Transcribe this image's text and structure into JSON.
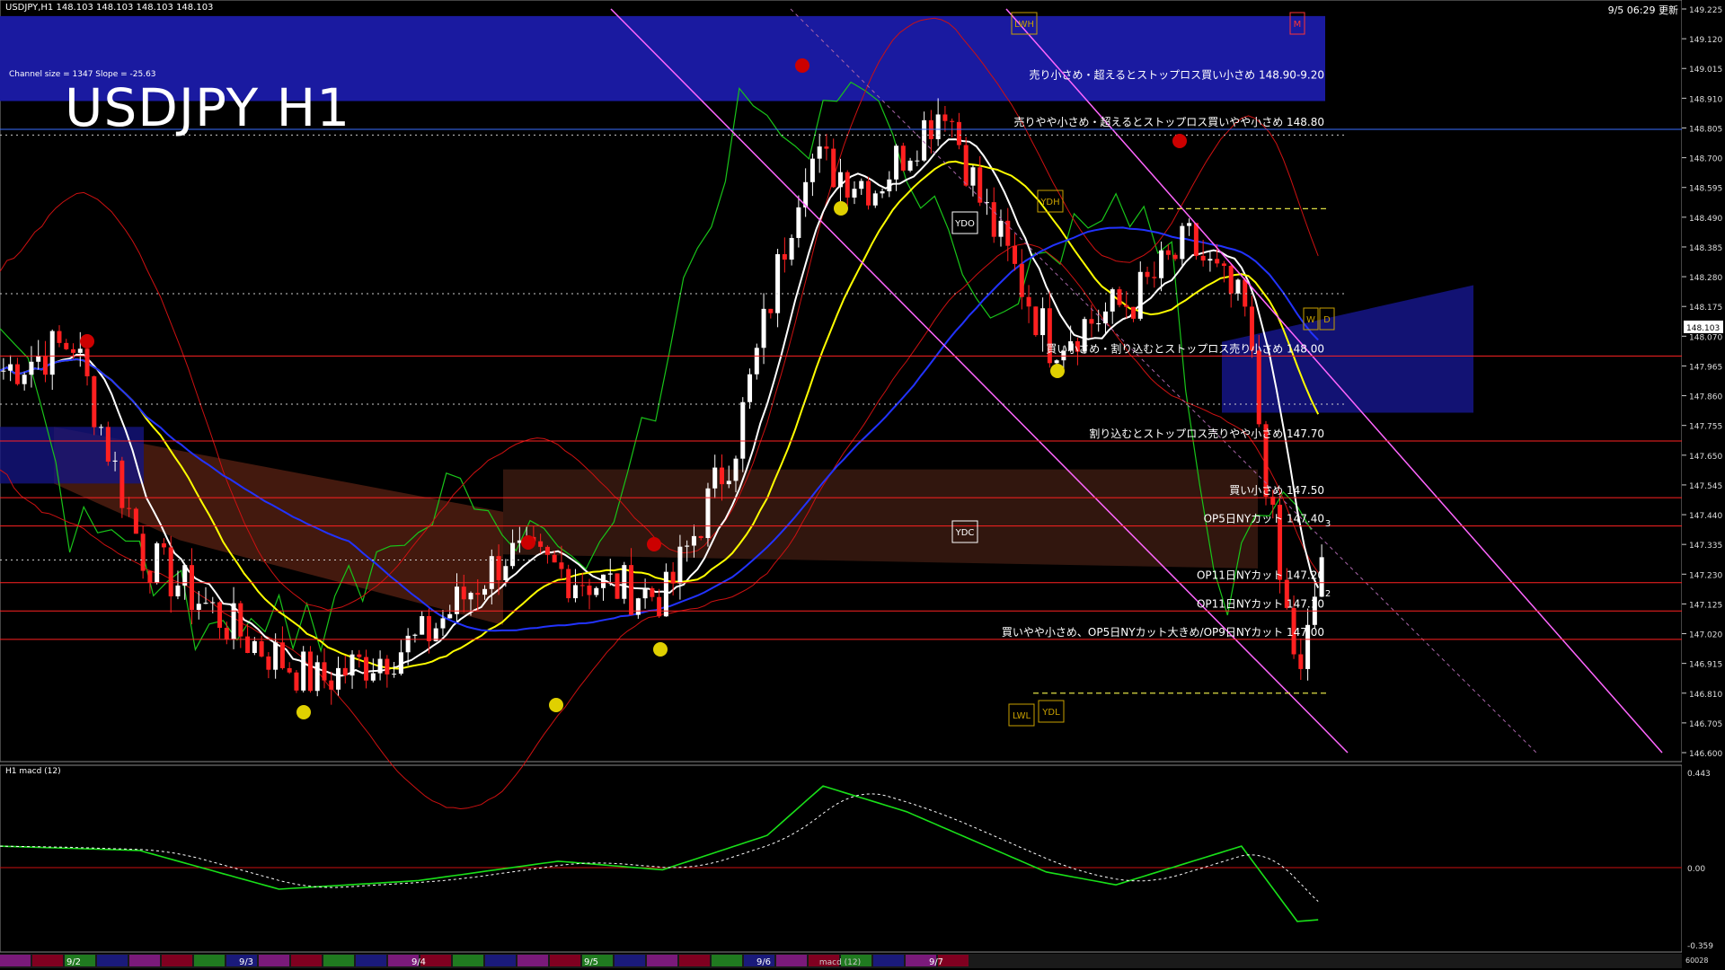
{
  "header": {
    "symbol_info": "USDJPY,H1  148.103 148.103 148.103 148.103",
    "channel_info": "Channel size = 1347 Slope = -25.63",
    "big_title": "USDJPY H1",
    "timestamp": "9/5 06:29 更新"
  },
  "price_axis": {
    "ticks": [
      "149.225",
      "149.120",
      "149.015",
      "148.910",
      "148.805",
      "148.700",
      "148.595",
      "148.490",
      "148.385",
      "148.280",
      "148.175",
      "148.070",
      "147.965",
      "147.860",
      "147.755",
      "147.650",
      "147.545",
      "147.440",
      "147.335",
      "147.230",
      "147.125",
      "147.020",
      "146.915",
      "146.810",
      "146.705",
      "146.600"
    ],
    "current_price": "148.103",
    "range": [
      146.6,
      149.225
    ]
  },
  "macd_axis": {
    "ticks": [
      "0.443",
      "0.00",
      "-0.359"
    ],
    "label": "H1  macd (12)",
    "right_bottom": "60028"
  },
  "levels": [
    {
      "label": "売り小さめ・超えるとストップロス買い小さめ 148.90-9.20",
      "price": 148.9,
      "color": "#1a1aa0",
      "kind": "band"
    },
    {
      "label": "売りやや小さめ・超えるとストップロス買いやや小さめ 148.80",
      "price": 148.8,
      "color": "#3a6fff",
      "kind": "line"
    },
    {
      "label": "買い小さめ・割り込むとストップロス売り小さめ 148.00",
      "price": 148.0,
      "color": "#ff2222",
      "kind": "line"
    },
    {
      "label": "割り込むとストップロス売りやや小さめ 147.70",
      "price": 147.7,
      "color": "#ff2222",
      "kind": "line"
    },
    {
      "label": "買い小さめ 147.50",
      "price": 147.5,
      "color": "#ff2222",
      "kind": "line"
    },
    {
      "label": "OP5日NYカット 147.40",
      "price": 147.4,
      "color": "#ff2222",
      "kind": "line"
    },
    {
      "label": "OP11日NYカット 147.20",
      "price": 147.2,
      "color": "#ff2222",
      "kind": "line"
    },
    {
      "label": "OP11日NYカット 147.10",
      "price": 147.1,
      "color": "#ff2222",
      "kind": "line"
    },
    {
      "label": "買いやや小さめ、OP5日NYカット大きめ/OP9日NYカット 147.00",
      "price": 147.0,
      "color": "#ff2222",
      "kind": "line"
    }
  ],
  "markers": [
    {
      "label": "LWH",
      "color": "#c8a000"
    },
    {
      "label": "M",
      "color": "#ff3333"
    },
    {
      "label": "YDH",
      "color": "#c8a000"
    },
    {
      "label": "YDO",
      "color": "#ffffff"
    },
    {
      "label": "YDC",
      "color": "#ffffff"
    },
    {
      "label": "LWL",
      "color": "#c8a000"
    },
    {
      "label": "YDL",
      "color": "#c8a000"
    },
    {
      "label": "W",
      "color": "#c8a000"
    },
    {
      "label": "D",
      "color": "#c8a000"
    },
    {
      "label": "3",
      "color": "#ffffff"
    },
    {
      "label": "2",
      "color": "#ffffff"
    }
  ],
  "date_labels": [
    "9/2",
    "9/3",
    "9/4",
    "9/5",
    "9/6",
    "9/7"
  ],
  "bottom_tag": "macd (12)",
  "colors": {
    "background": "#000000",
    "band": "#1a1aa0",
    "bull": "#ffffff",
    "bear": "#ff2020",
    "ma_white": "#ffffff",
    "ma_yellow": "#ffff00",
    "ma_blue": "#2233ff",
    "green": "#19c419",
    "magenta": "#ff66ff",
    "macd": "#19e019",
    "signal": "#ffffff"
  }
}
